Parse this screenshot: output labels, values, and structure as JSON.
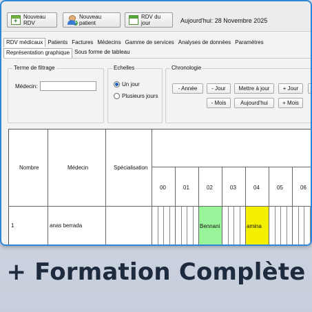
{
  "toolbar": {
    "new_rdv": "Nouveau RDV",
    "new_patient": "Nouveau patient",
    "rdv_today": "RDV du jour",
    "today_text": "Aujourd'hui: 28 Novembre 2025"
  },
  "menu": [
    "RDV médicaux",
    "Patients",
    "Factures",
    "Médecins",
    "Gamme de services",
    "Analyses de données",
    "Paramètres"
  ],
  "subtabs": [
    "Représentation graphique",
    "Sous forme de tableau"
  ],
  "filter": {
    "title": "Terme de filtrage",
    "medecin_label": "Médecin:",
    "medecin_value": ""
  },
  "scales": {
    "title": "Echelles",
    "one_day": "Un jour",
    "several_days": "Plusieurs jours",
    "selected": "Un jour"
  },
  "chronology": {
    "title": "Chronologie",
    "row1": [
      "- Année",
      "- Jour",
      "Mettre à jour",
      "+ Jour"
    ],
    "row2": [
      "- Mois",
      "Aujourd'hui",
      "+ Mois"
    ]
  },
  "table": {
    "headers": {
      "nombre": "Nombre",
      "medecin": "Médecin",
      "specialisation": "Spécialisation"
    },
    "hours": [
      "00",
      "01",
      "02",
      "03",
      "04",
      "05",
      "06"
    ],
    "rows": [
      {
        "nombre": "1",
        "medecin": "anas berrada",
        "specialisation": "",
        "appointments": [
          {
            "label": "Bennani",
            "color": "#99f599"
          },
          {
            "label": "amina",
            "color": "#f5f000"
          }
        ]
      }
    ]
  },
  "banner": "+ Formation Complète"
}
